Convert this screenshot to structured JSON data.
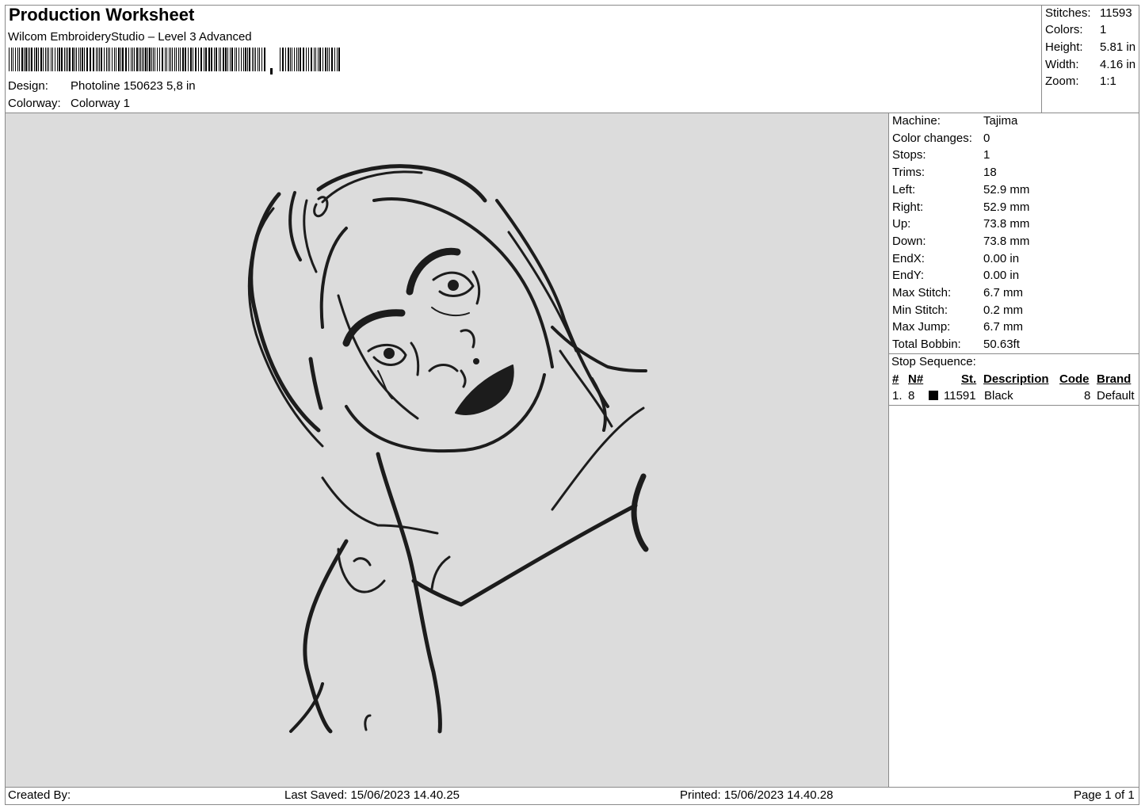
{
  "header": {
    "title": "Production Worksheet",
    "software": "Wilcom EmbroideryStudio – Level 3 Advanced",
    "design_label": "Design:",
    "design_value": "Photoline 150623 5,8 in",
    "colorway_label": "Colorway:",
    "colorway_value": "Colorway 1"
  },
  "summary": {
    "stitches_label": "Stitches:",
    "stitches_value": "11593",
    "colors_label": "Colors:",
    "colors_value": "1",
    "height_label": "Height:",
    "height_value": "5.81 in",
    "width_label": "Width:",
    "width_value": "4.16 in",
    "zoom_label": "Zoom:",
    "zoom_value": "1:1"
  },
  "details": [
    {
      "label": "Machine:",
      "value": "Tajima"
    },
    {
      "label": "Color changes:",
      "value": "0"
    },
    {
      "label": "Stops:",
      "value": "1"
    },
    {
      "label": "Trims:",
      "value": "18"
    },
    {
      "label": "Left:",
      "value": "52.9 mm"
    },
    {
      "label": "Right:",
      "value": "52.9 mm"
    },
    {
      "label": "Up:",
      "value": "73.8 mm"
    },
    {
      "label": "Down:",
      "value": "73.8 mm"
    },
    {
      "label": "EndX:",
      "value": "0.00 in"
    },
    {
      "label": "EndY:",
      "value": "0.00 in"
    },
    {
      "label": "Max Stitch:",
      "value": "6.7 mm"
    },
    {
      "label": "Min Stitch:",
      "value": "0.2 mm"
    },
    {
      "label": "Max Jump:",
      "value": "6.7 mm"
    },
    {
      "label": "Total Bobbin:",
      "value": "50.63ft"
    }
  ],
  "stop_sequence": {
    "title": "Stop Sequence:",
    "columns": [
      "#",
      "N#",
      "St.",
      "Description",
      "Code",
      "Brand"
    ],
    "rows": [
      {
        "index": "1.",
        "needle": "8",
        "color": "#000000",
        "stitches": "11591",
        "description": "Black",
        "code": "8",
        "brand": "Default"
      }
    ]
  },
  "footer": {
    "created_by": "Created By:",
    "last_saved": "Last Saved: 15/06/2023 14.40.25",
    "printed": "Printed: 15/06/2023 14.40.28",
    "page": "Page 1 of 1"
  }
}
